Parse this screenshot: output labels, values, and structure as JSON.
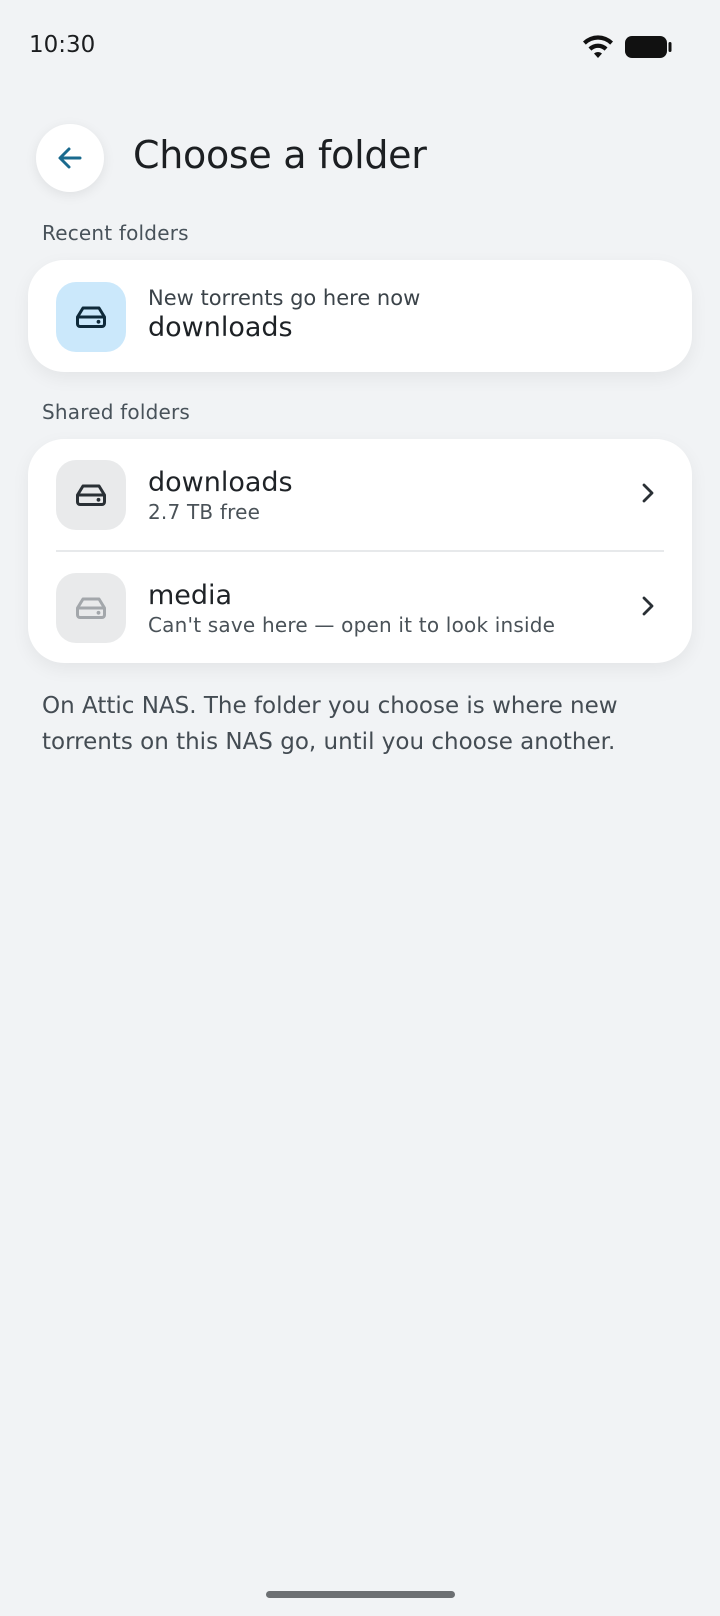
{
  "status_bar": {
    "time": "10:30"
  },
  "header": {
    "title": "Choose a folder",
    "back_icon": "arrow-left-icon"
  },
  "recent": {
    "section_label": "Recent folders",
    "items": [
      {
        "subtitle": "New torrents go here now",
        "name": "downloads",
        "icon": "drive-icon"
      }
    ]
  },
  "shared": {
    "section_label": "Shared folders",
    "items": [
      {
        "name": "downloads",
        "detail": "2.7 TB free",
        "icon": "drive-icon",
        "enabled": true
      },
      {
        "name": "media",
        "detail": "Can't save here — open it to look inside",
        "icon": "drive-icon",
        "enabled": false
      }
    ]
  },
  "footnote": "On Attic NAS. The folder you choose is where new torrents on this NAS go, until you choose another.",
  "colors": {
    "accent": "#1a6a8e",
    "tile_blue": "#cbe8fb",
    "tile_grey": "#e9eaeb",
    "background": "#f1f3f5"
  }
}
